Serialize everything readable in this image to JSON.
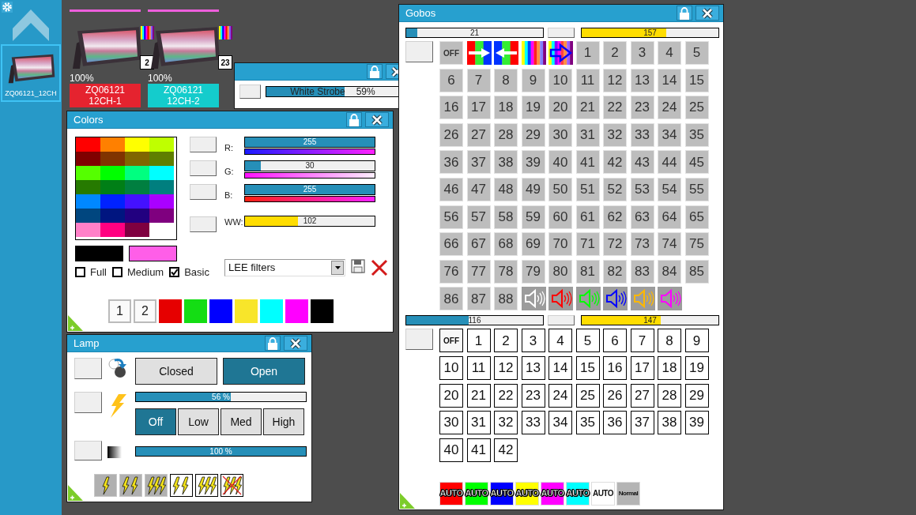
{
  "sidebar": {
    "fixtures": [
      {
        "label": "ZQ06121_12CH",
        "selected": true
      }
    ]
  },
  "stage": {
    "fixtures": [
      {
        "address": "2",
        "intensity": "100%",
        "model": "ZQ06121",
        "mode": "12CH-1",
        "color": "#e5232f"
      },
      {
        "address": "23",
        "intensity": "100%",
        "model": "ZQ06121",
        "mode": "12CH-2",
        "color": "#14cccc"
      }
    ]
  },
  "strobe_window": {
    "slider": {
      "label": "White Strobe",
      "reading": "59%",
      "level": 0.59
    }
  },
  "colors": {
    "title": "Colors",
    "palette": [
      {
        "color": "#ff0000"
      },
      {
        "color": "#ff8000"
      },
      {
        "color": "#ffff00"
      },
      {
        "color": "#bfff00"
      },
      {
        "color": "#800000"
      },
      {
        "color": "#803300"
      },
      {
        "color": "#806600"
      },
      {
        "color": "#5f7f00"
      },
      {
        "color": "#55ff00"
      },
      {
        "color": "#00ff00"
      },
      {
        "color": "#00ff80"
      },
      {
        "color": "#00ffff"
      },
      {
        "color": "#267a00"
      },
      {
        "color": "#007f16"
      },
      {
        "color": "#007f40"
      },
      {
        "color": "#007f7f"
      },
      {
        "color": "#0088ff"
      },
      {
        "color": "#0022ff"
      },
      {
        "color": "#4411ff"
      },
      {
        "color": "#aa00ff"
      },
      {
        "color": "#00467f"
      },
      {
        "color": "#001580"
      },
      {
        "color": "#220080"
      },
      {
        "color": "#7f007f"
      },
      {
        "color": "#ff80c8"
      },
      {
        "color": "#ff0080"
      },
      {
        "color": "#7f0040"
      }
    ],
    "channels": [
      {
        "kind": "rgb",
        "label": "R:",
        "value": "255",
        "level": 1
      },
      {
        "kind": "rgb",
        "label": "G:",
        "value": "30",
        "level": 0.12
      },
      {
        "kind": "rgb",
        "label": "B:",
        "value": "255",
        "level": 1
      },
      {
        "kind": "white",
        "label": "WW:",
        "value": "102",
        "level": 0.41
      }
    ],
    "recent_colors": [
      {
        "color": "#000000"
      },
      {
        "color": "#ff5ee8"
      }
    ],
    "palette_sizes": [
      {
        "label": "Full",
        "checked": false
      },
      {
        "label": "Medium",
        "checked": false
      },
      {
        "label": "Basic",
        "checked": true
      }
    ],
    "filter_select": {
      "value": "LEE filters"
    },
    "presets": [
      {
        "kind": "slot",
        "label": "1"
      },
      {
        "kind": "slot",
        "label": "2"
      },
      {
        "kind": "swatch",
        "color": "#e60000"
      },
      {
        "kind": "swatch",
        "color": "#14dd14"
      },
      {
        "kind": "swatch",
        "color": "#0000ff"
      },
      {
        "kind": "swatch",
        "color": "#f8e52a"
      },
      {
        "kind": "swatch",
        "color": "#00ffff"
      },
      {
        "kind": "swatch",
        "color": "#ff00ff"
      },
      {
        "kind": "swatch",
        "color": "#000000"
      }
    ]
  },
  "lamp": {
    "title": "Lamp",
    "shutter": [
      {
        "label": "Closed",
        "selected": false
      },
      {
        "label": "Open",
        "selected": true
      }
    ],
    "strobe": {
      "value": "56 %",
      "level": 0.56
    },
    "strobe_modes": [
      {
        "label": "Off",
        "selected": true
      },
      {
        "label": "Low",
        "selected": false
      },
      {
        "label": "Med",
        "selected": false
      },
      {
        "label": "High",
        "selected": false
      }
    ],
    "dimmer": {
      "value": "100 %",
      "level": 1
    }
  },
  "gobos": {
    "title": "Gobos",
    "wheels": [
      {
        "kind": "filled",
        "slider": {
          "value": "21",
          "level": 0.082
        },
        "rotation": {
          "value": "157",
          "level": 0.616
        },
        "items": [
          {
            "kind": "off",
            "label": "OFF"
          },
          {
            "kind": "forward"
          },
          {
            "kind": "reverse"
          },
          {
            "kind": "rainbow"
          },
          {
            "kind": "scroll"
          },
          {
            "kind": "number",
            "label": "1"
          },
          {
            "kind": "number",
            "label": "2"
          },
          {
            "kind": "number",
            "label": "3"
          },
          {
            "kind": "number",
            "label": "4"
          },
          {
            "kind": "number",
            "label": "5"
          },
          {
            "kind": "number",
            "label": "6"
          },
          {
            "kind": "number",
            "label": "7"
          },
          {
            "kind": "number",
            "label": "8"
          },
          {
            "kind": "number",
            "label": "9"
          },
          {
            "kind": "number",
            "label": "10"
          },
          {
            "kind": "number",
            "label": "11"
          },
          {
            "kind": "number",
            "label": "12"
          },
          {
            "kind": "number",
            "label": "13"
          },
          {
            "kind": "number",
            "label": "14"
          },
          {
            "kind": "number",
            "label": "15"
          },
          {
            "kind": "number",
            "label": "16"
          },
          {
            "kind": "number",
            "label": "17"
          },
          {
            "kind": "number",
            "label": "18"
          },
          {
            "kind": "number",
            "label": "19"
          },
          {
            "kind": "number",
            "label": "20"
          },
          {
            "kind": "number",
            "label": "21"
          },
          {
            "kind": "number",
            "label": "22"
          },
          {
            "kind": "number",
            "label": "23"
          },
          {
            "kind": "number",
            "label": "24"
          },
          {
            "kind": "number",
            "label": "25"
          },
          {
            "kind": "number",
            "label": "26"
          },
          {
            "kind": "number",
            "label": "27"
          },
          {
            "kind": "number",
            "label": "28"
          },
          {
            "kind": "number",
            "label": "29"
          },
          {
            "kind": "number",
            "label": "30"
          },
          {
            "kind": "number",
            "label": "31"
          },
          {
            "kind": "number",
            "label": "32"
          },
          {
            "kind": "number",
            "label": "33"
          },
          {
            "kind": "number",
            "label": "34"
          },
          {
            "kind": "number",
            "label": "35"
          },
          {
            "kind": "number",
            "label": "36"
          },
          {
            "kind": "number",
            "label": "37"
          },
          {
            "kind": "number",
            "label": "38"
          },
          {
            "kind": "number",
            "label": "39"
          },
          {
            "kind": "number",
            "label": "40"
          },
          {
            "kind": "number",
            "label": "41"
          },
          {
            "kind": "number",
            "label": "42"
          },
          {
            "kind": "number",
            "label": "43"
          },
          {
            "kind": "number",
            "label": "44"
          },
          {
            "kind": "number",
            "label": "45"
          },
          {
            "kind": "number",
            "label": "46"
          },
          {
            "kind": "number",
            "label": "47"
          },
          {
            "kind": "number",
            "label": "48"
          },
          {
            "kind": "number",
            "label": "49"
          },
          {
            "kind": "number",
            "label": "50"
          },
          {
            "kind": "number",
            "label": "51"
          },
          {
            "kind": "number",
            "label": "52"
          },
          {
            "kind": "number",
            "label": "53"
          },
          {
            "kind": "number",
            "label": "54"
          },
          {
            "kind": "number",
            "label": "55"
          },
          {
            "kind": "number",
            "label": "56"
          },
          {
            "kind": "number",
            "label": "57"
          },
          {
            "kind": "number",
            "label": "58"
          },
          {
            "kind": "number",
            "label": "59"
          },
          {
            "kind": "number",
            "label": "60"
          },
          {
            "kind": "number",
            "label": "61"
          },
          {
            "kind": "number",
            "label": "62"
          },
          {
            "kind": "number",
            "label": "63"
          },
          {
            "kind": "number",
            "label": "64"
          },
          {
            "kind": "number",
            "label": "65"
          },
          {
            "kind": "number",
            "label": "66"
          },
          {
            "kind": "number",
            "label": "67"
          },
          {
            "kind": "number",
            "label": "68"
          },
          {
            "kind": "number",
            "label": "69"
          },
          {
            "kind": "number",
            "label": "70"
          },
          {
            "kind": "number",
            "label": "71"
          },
          {
            "kind": "number",
            "label": "72"
          },
          {
            "kind": "number",
            "label": "73"
          },
          {
            "kind": "number",
            "label": "74"
          },
          {
            "kind": "number",
            "label": "75"
          },
          {
            "kind": "number",
            "label": "76"
          },
          {
            "kind": "number",
            "label": "77"
          },
          {
            "kind": "number",
            "label": "78"
          },
          {
            "kind": "number",
            "label": "79"
          },
          {
            "kind": "number",
            "label": "80"
          },
          {
            "kind": "number",
            "label": "81"
          },
          {
            "kind": "number",
            "label": "82"
          },
          {
            "kind": "number",
            "label": "83"
          },
          {
            "kind": "number",
            "label": "84"
          },
          {
            "kind": "number",
            "label": "85"
          },
          {
            "kind": "number",
            "label": "86"
          },
          {
            "kind": "number",
            "label": "87"
          },
          {
            "kind": "number",
            "label": "88"
          },
          {
            "kind": "sound",
            "color": "#ffffff"
          },
          {
            "kind": "sound",
            "color": "#ff0000"
          },
          {
            "kind": "sound",
            "color": "#00ff00"
          },
          {
            "kind": "sound",
            "color": "#0000ff"
          },
          {
            "kind": "sound",
            "color": "#ffb800"
          },
          {
            "kind": "sound",
            "color": "#ff00ff"
          }
        ]
      },
      {
        "kind": "outlined",
        "slider": {
          "value": "116",
          "level": 0.455
        },
        "rotation": {
          "value": "147",
          "level": 0.576
        },
        "items": [
          {
            "kind": "off",
            "label": "OFF"
          },
          {
            "kind": "number",
            "label": "1"
          },
          {
            "kind": "number",
            "label": "2"
          },
          {
            "kind": "number",
            "label": "3"
          },
          {
            "kind": "number",
            "label": "4"
          },
          {
            "kind": "number",
            "label": "5"
          },
          {
            "kind": "number",
            "label": "6"
          },
          {
            "kind": "number",
            "label": "7"
          },
          {
            "kind": "number",
            "label": "8"
          },
          {
            "kind": "number",
            "label": "9"
          },
          {
            "kind": "number",
            "label": "10"
          },
          {
            "kind": "number",
            "label": "11"
          },
          {
            "kind": "number",
            "label": "12"
          },
          {
            "kind": "number",
            "label": "13"
          },
          {
            "kind": "number",
            "label": "14"
          },
          {
            "kind": "number",
            "label": "15"
          },
          {
            "kind": "number",
            "label": "16"
          },
          {
            "kind": "number",
            "label": "17"
          },
          {
            "kind": "number",
            "label": "18"
          },
          {
            "kind": "number",
            "label": "19"
          },
          {
            "kind": "number",
            "label": "20"
          },
          {
            "kind": "number",
            "label": "21"
          },
          {
            "kind": "number",
            "label": "22"
          },
          {
            "kind": "number",
            "label": "23"
          },
          {
            "kind": "number",
            "label": "24"
          },
          {
            "kind": "number",
            "label": "25"
          },
          {
            "kind": "number",
            "label": "26"
          },
          {
            "kind": "number",
            "label": "27"
          },
          {
            "kind": "number",
            "label": "28"
          },
          {
            "kind": "number",
            "label": "29"
          },
          {
            "kind": "number",
            "label": "30"
          },
          {
            "kind": "number",
            "label": "31"
          },
          {
            "kind": "number",
            "label": "32"
          },
          {
            "kind": "number",
            "label": "33"
          },
          {
            "kind": "number",
            "label": "34"
          },
          {
            "kind": "number",
            "label": "35"
          },
          {
            "kind": "number",
            "label": "36"
          },
          {
            "kind": "number",
            "label": "37"
          },
          {
            "kind": "number",
            "label": "38"
          },
          {
            "kind": "number",
            "label": "39"
          },
          {
            "kind": "number",
            "label": "40"
          },
          {
            "kind": "number",
            "label": "41"
          },
          {
            "kind": "number",
            "label": "42"
          }
        ]
      }
    ],
    "auto_buttons": [
      {
        "label": "AUTO",
        "color": "#ff0000",
        "dark_text": false
      },
      {
        "label": "AUTO",
        "color": "#00ff00",
        "dark_text": false
      },
      {
        "label": "AUTO",
        "color": "#0000ff",
        "dark_text": false
      },
      {
        "label": "AUTO",
        "color": "#ffff00",
        "dark_text": false
      },
      {
        "label": "AUTO",
        "color": "#ff00ff",
        "dark_text": false
      },
      {
        "label": "AUTO",
        "color": "#00ffff",
        "dark_text": false
      },
      {
        "label": "AUTO",
        "color": "#ffffff",
        "dark_text": true
      },
      {
        "label": "Normal",
        "color": "#b4b4b4",
        "dark_text": true
      }
    ]
  }
}
